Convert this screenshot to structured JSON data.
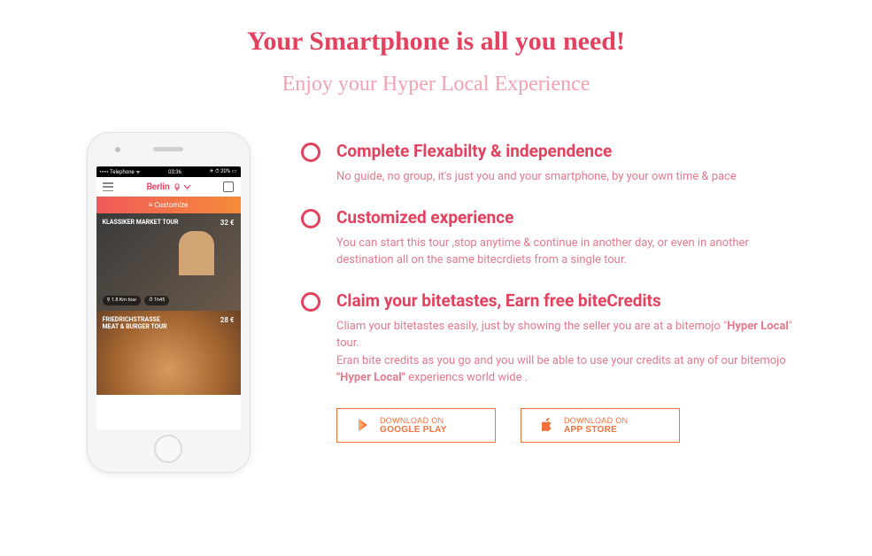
{
  "heading": "Your Smartphone is all you need!",
  "subheading": "Enjoy your Hyper Local Experience",
  "phone": {
    "status_left": "••••• Telephone ᯤ",
    "status_time": "03:36",
    "status_right": "✈ ⏱ 20% ▭",
    "city": "Berlin",
    "customize": "≡ Customize",
    "tours": [
      {
        "title": "KLASSIKER MARKET TOUR",
        "price": "32 €",
        "pill1": "⚲ 1.8 Km tour",
        "pill2": "⏱ 1h45"
      },
      {
        "title": "FRIEDRICHSTRASSE\nMEAT & BURGER TOUR",
        "price": "28 €"
      }
    ]
  },
  "features": [
    {
      "title": "Complete  Flexabilty & independence",
      "text": "No guide, no group, it's just you and your smartphone, by your own time & pace"
    },
    {
      "title": "Customized experience",
      "text": "You can start this tour ,stop anytime & continue in another day, or even in another destination all on the same bitecrdiets from a single tour."
    },
    {
      "title": "Claim your bitetastes, Earn free biteCredits",
      "text_html": "Cliam your bitetastes easily, just by showing the seller you are at a bitemojo \"<b>Hyper Local</b>\" tour.<br>Eran bite credits as you go and you will be able to use your credits at any of our bitemojo <b>\"Hyper Local\"</b> experiencs world wide ."
    }
  ],
  "cta": {
    "line1": "DOWNLOAD ON",
    "google": "GOOGLE PLAY",
    "apple": "APP STORE"
  }
}
